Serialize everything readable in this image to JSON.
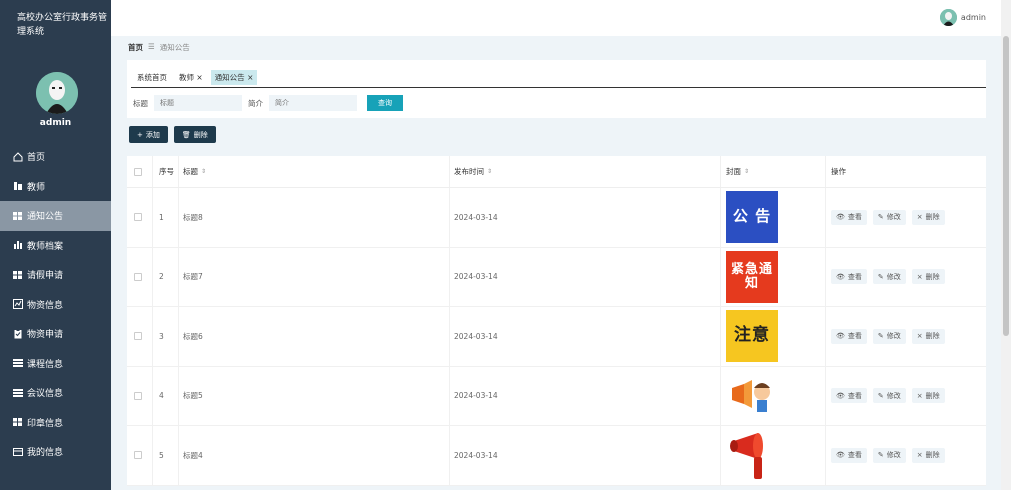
{
  "app": {
    "title": "高校办公室行政事务管理系统",
    "user": "admin"
  },
  "sidebar": {
    "items": [
      {
        "label": "首页",
        "icon": "home-icon"
      },
      {
        "label": "教师",
        "icon": "teacher-icon"
      },
      {
        "label": "通知公告",
        "icon": "grid-icon",
        "active": true
      },
      {
        "label": "教师档案",
        "icon": "bar-chart-icon"
      },
      {
        "label": "请假申请",
        "icon": "grid-icon"
      },
      {
        "label": "物资信息",
        "icon": "line-chart-icon"
      },
      {
        "label": "物资申请",
        "icon": "clipboard-icon"
      },
      {
        "label": "课程信息",
        "icon": "list-icon"
      },
      {
        "label": "会议信息",
        "icon": "list-icon"
      },
      {
        "label": "印章信息",
        "icon": "grid-icon"
      },
      {
        "label": "我的信息",
        "icon": "card-icon"
      }
    ]
  },
  "breadcrumb": {
    "home": "首页",
    "separator": "☰",
    "current": "通知公告"
  },
  "tabs": [
    {
      "label": "系统首页",
      "closable": false
    },
    {
      "label": "教师",
      "closable": true
    },
    {
      "label": "通知公告",
      "closable": true,
      "active": true
    }
  ],
  "search": {
    "title_label": "标题",
    "title_placeholder": "标题",
    "intro_label": "简介",
    "intro_placeholder": "简介",
    "query_button": "查询"
  },
  "actions": {
    "add": "添加",
    "delete": "删除"
  },
  "table": {
    "headers": {
      "no": "序号",
      "title": "标题",
      "time": "发布时间",
      "cover": "封面",
      "ops": "操作"
    },
    "op_labels": {
      "view": "查看",
      "edit": "修改",
      "delete": "删除"
    },
    "rows": [
      {
        "no": "1",
        "title": "标题8",
        "time": "2024-03-14",
        "cover_text": "公 告",
        "cover_bg": "#2b4fc2",
        "cover_fg": "#ffffff"
      },
      {
        "no": "2",
        "title": "标题7",
        "time": "2024-03-14",
        "cover_text": "紧急通知",
        "cover_bg": "#e53a1e",
        "cover_fg": "#ffffff"
      },
      {
        "no": "3",
        "title": "标题6",
        "time": "2024-03-14",
        "cover_text": "注意",
        "cover_bg": "#f6c620",
        "cover_fg": "#222222"
      },
      {
        "no": "4",
        "title": "标题5",
        "time": "2024-03-14",
        "cover_text": "",
        "cover_bg": "#ffffff",
        "cover_fg": "#e86a1b"
      },
      {
        "no": "5",
        "title": "标题4",
        "time": "2024-03-14",
        "cover_text": "",
        "cover_bg": "#ffffff",
        "cover_fg": "#d92b1e"
      }
    ]
  }
}
